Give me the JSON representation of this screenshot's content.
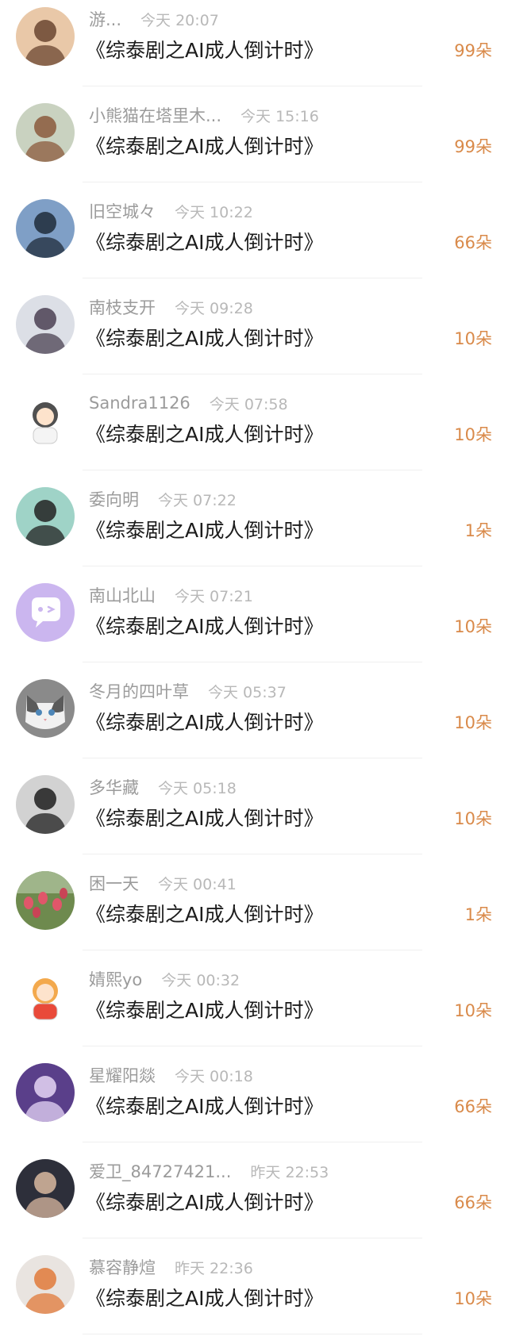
{
  "gift_list": {
    "items": [
      {
        "name": "游...",
        "time": "今天 20:07",
        "title": "《综泰剧之AI成人倒计时》",
        "count": "99朵",
        "avatar": "woman-portrait-icon",
        "avatar_bg": "#e9c8a8",
        "avatar_fg": "#6a4530"
      },
      {
        "name": "小熊猫在塔里木...",
        "time": "今天 15:16",
        "title": "《综泰剧之AI成人倒计时》",
        "count": "99朵",
        "avatar": "baby-photo-icon",
        "avatar_bg": "#c9d2c0",
        "avatar_fg": "#8b5a3c"
      },
      {
        "name": "旧空城々",
        "time": "今天 10:22",
        "title": "《综泰剧之AI成人倒计时》",
        "count": "66朵",
        "avatar": "lake-silhouette-icon",
        "avatar_bg": "#7f9fc6",
        "avatar_fg": "#1f2b3a"
      },
      {
        "name": "南枝支开",
        "time": "今天 09:28",
        "title": "《综泰剧之AI成人倒计时》",
        "count": "10朵",
        "avatar": "man-portrait-icon",
        "avatar_bg": "#dcdfe6",
        "avatar_fg": "#4b4152"
      },
      {
        "name": "Sandra1126",
        "time": "今天 07:58",
        "title": "《综泰剧之AI成人倒计时》",
        "count": "10朵",
        "avatar": "cartoon-boy-icon",
        "avatar_bg": "#ffffff",
        "avatar_fg": "#3d3d3d"
      },
      {
        "name": "委向明",
        "time": "今天 07:22",
        "title": "《综泰剧之AI成人倒计时》",
        "count": "1朵",
        "avatar": "sunglasses-man-icon",
        "avatar_bg": "#9fd3c7",
        "avatar_fg": "#222222"
      },
      {
        "name": "南山北山",
        "time": "今天 07:21",
        "title": "《综泰剧之AI成人倒计时》",
        "count": "10朵",
        "avatar": "chat-bubble-icon",
        "avatar_bg": "#cbb6ef",
        "avatar_fg": "#ffffff"
      },
      {
        "name": "冬月的四叶草",
        "time": "今天 05:37",
        "title": "《综泰剧之AI成人倒计时》",
        "count": "10朵",
        "avatar": "cat-icon",
        "avatar_bg": "#8a8a8a",
        "avatar_fg": "#f1f1f1"
      },
      {
        "name": "多华藏",
        "time": "今天 05:18",
        "title": "《综泰剧之AI成人倒计时》",
        "count": "10朵",
        "avatar": "bw-portrait-icon",
        "avatar_bg": "#d2d2d2",
        "avatar_fg": "#1e1e1e"
      },
      {
        "name": "困一天",
        "time": "今天 00:41",
        "title": "《综泰剧之AI成人倒计时》",
        "count": "1朵",
        "avatar": "tulips-icon",
        "avatar_bg": "#6e8a4e",
        "avatar_fg": "#e0576a"
      },
      {
        "name": "婧熙yo",
        "time": "今天 00:32",
        "title": "《综泰剧之AI成人倒计时》",
        "count": "10朵",
        "avatar": "cartoon-dragon-icon",
        "avatar_bg": "#ffffff",
        "avatar_fg": "#f2a03a"
      },
      {
        "name": "星耀阳燚",
        "time": "今天 00:18",
        "title": "《综泰剧之AI成人倒计时》",
        "count": "66朵",
        "avatar": "purple-anime-icon",
        "avatar_bg": "#5a3f8a",
        "avatar_fg": "#e6d6f5"
      },
      {
        "name": "爱卫_84727421...",
        "time": "昨天 22:53",
        "title": "《综泰剧之AI成人倒计时》",
        "count": "66朵",
        "avatar": "young-man-icon",
        "avatar_bg": "#2d2f3a",
        "avatar_fg": "#d9b8a0"
      },
      {
        "name": "慕容静煊",
        "time": "昨天 22:36",
        "title": "《综泰剧之AI成人倒计时》",
        "count": "10朵",
        "avatar": "hanfu-girl-icon",
        "avatar_bg": "#e9e4e0",
        "avatar_fg": "#e07a3a"
      }
    ]
  }
}
